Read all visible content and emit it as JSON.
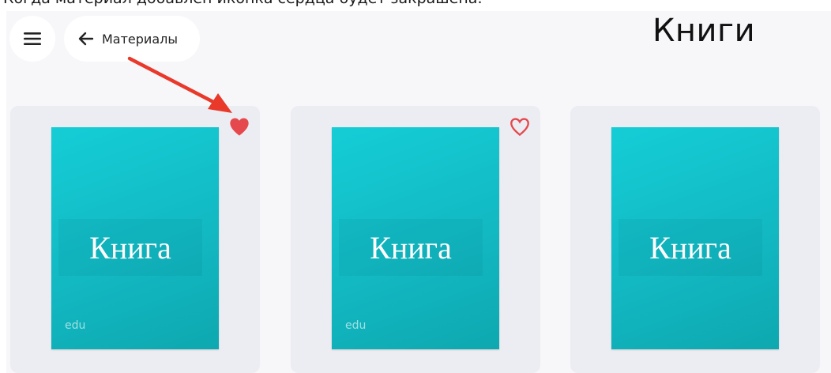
{
  "caption": "Когда материал добавлен иконка сердца будет закрашена.",
  "header": {
    "menu_icon": "hamburger-menu-icon",
    "back_icon": "arrow-left-icon",
    "back_label": "Материалы",
    "title": "Книги"
  },
  "cards": [
    {
      "cover_title": "Книга",
      "cover_footer": "edu",
      "favorite": true,
      "heart_icon": "heart-filled-icon"
    },
    {
      "cover_title": "Книга",
      "cover_footer": "edu",
      "favorite": false,
      "heart_icon": "heart-outline-icon"
    },
    {
      "cover_title": "Книга",
      "cover_footer": "",
      "favorite": null,
      "heart_icon": ""
    }
  ],
  "colors": {
    "heart": "#e5484d",
    "annotation_arrow": "#e8392b",
    "cover_gradient_start": "#15cdd6",
    "cover_gradient_end": "#0ea8b0",
    "app_background": "#f7f7fa",
    "card_background": "#ecedf2"
  }
}
